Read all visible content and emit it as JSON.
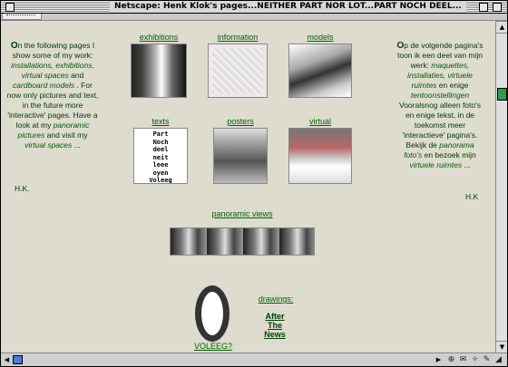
{
  "window": {
    "title": "Netscape: Henk Klok's pages...NEITHER PART NOR LOT...PART NOCH DEEL..."
  },
  "left_text": {
    "html": "<b>O</b>n the following pages I show some of my work: <i>installations, exhibitions, virtual spaces</i> and <i>cardboard models</i> . For now only pictures and text, in the future more 'interactive' pages. Have a look at my <i>panoramic pictures</i> and visit my <i>virtual spaces</i> ...",
    "signature": "H.K."
  },
  "right_text": {
    "html": "<b>O</b>p de volgende pagina's toon ik een deel van mijn werk: <i>maquettes, installaties, virtuele ruimtes</i> en enige <i>tentoonstellingen</i> Vooralsnog alleen foto's en enige tekst, in de toekomst meer 'interactieve' pagina's. Bekijk de <i>panorama foto's</i> en bezoek mijn <i>virtuele ruimtes</i> ...",
    "signature": "H.K"
  },
  "nav": {
    "exhibitions": "exhibitions",
    "information": "information",
    "models": "models",
    "texts": "texts",
    "posters": "posters",
    "virtual": "virtual",
    "panoramic_views": "panoramic views",
    "voleeg": "VOLEEG?"
  },
  "texts_thumb_lines": [
    "Part",
    "Noch",
    "deel",
    "neit",
    "leee",
    "oyen",
    "Voleeg",
    "Voleeg"
  ],
  "drawings": {
    "label": "drawings:",
    "after": "After",
    "the": "The",
    "news": "News"
  }
}
